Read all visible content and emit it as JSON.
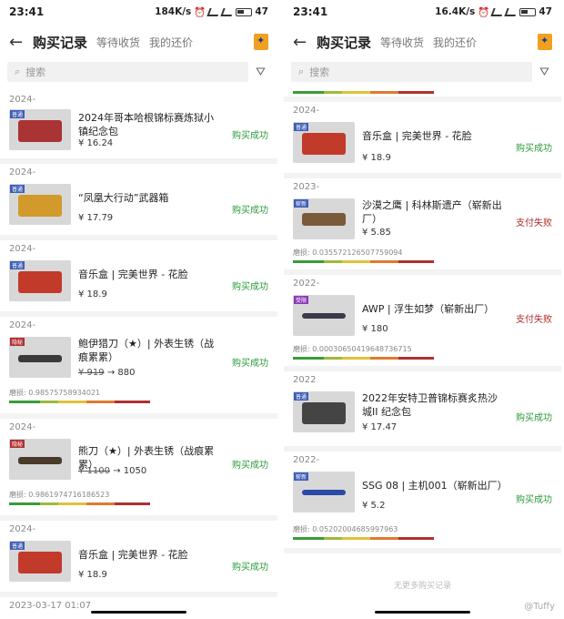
{
  "colors": {
    "success": "#2e9a3a",
    "fail": "#b02a2a"
  },
  "left": {
    "status": {
      "time": "23:41",
      "speed": "184K/s",
      "battery": "47"
    },
    "header": {
      "title": "购买记录",
      "tab1": "等待收货",
      "tab2": "我的还价"
    },
    "search": {
      "placeholder": "搜索"
    },
    "items": [
      {
        "date": "2024-",
        "name": "2024年哥本哈根锦标赛炼狱小镇纪念包",
        "price": "¥ 16.24",
        "status": "购买成功"
      },
      {
        "date": "2024-",
        "name": "“凤凰大行动”武器箱",
        "price": "¥ 17.79",
        "status": "购买成功"
      },
      {
        "date": "2024-",
        "name": "音乐盒 | 完美世界 - 花脸",
        "price": "¥ 18.9",
        "status": "购买成功"
      },
      {
        "date": "2024-",
        "name": "鲍伊猎刀（★）| 外表生锈（战痕累累）",
        "price_old": "¥ 919",
        "price_new": "880",
        "status": "购买成功",
        "wear": "磨损: 0.98575758934021"
      },
      {
        "date": "2024-",
        "name": "熊刀（★）| 外表生锈（战痕累累）",
        "price_old": "¥ 1100",
        "price_new": "1050",
        "status": "购买成功",
        "wear": "磨损: 0.9861974716186523"
      },
      {
        "date": "2024-",
        "name": "音乐盒 | 完美世界 - 花脸",
        "price": "¥ 18.9",
        "status": "购买成功"
      },
      {
        "date": "2023-03-17 01:07"
      }
    ]
  },
  "right": {
    "status": {
      "time": "23:41",
      "speed": "16.4K/s",
      "battery": "47"
    },
    "header": {
      "title": "购买记录",
      "tab1": "等待收货",
      "tab2": "我的还价"
    },
    "search": {
      "placeholder": "搜索"
    },
    "items": [
      {
        "date": "2024-",
        "name": "音乐盒 | 完美世界 - 花脸",
        "price": "¥ 18.9",
        "status": "购买成功"
      },
      {
        "date": "2023-",
        "name": "沙漠之鹰 | 科林斯遗产（崭新出厂）",
        "price": "¥ 5.85",
        "status": "支付失败",
        "wear": "磨损: 0.0355721265077590​94"
      },
      {
        "date": "2022-",
        "name": "AWP | 浮生如梦（崭新出厂）",
        "price": "¥ 180",
        "status": "支付失败",
        "wear": "磨损: 0.0003065041964873​6715"
      },
      {
        "date": "2022",
        "name": "2022年安特卫普锦标赛炙热沙城II 纪念包",
        "price": "¥ 17.47",
        "status": "购买成功"
      },
      {
        "date": "2022-",
        "name": "SSG 08 | 主机001（崭新出厂）",
        "price": "¥ 5.2",
        "status": "购买成功",
        "wear": "磨损: 0.0520200468599​7963"
      }
    ],
    "footer": "无更多购买记录"
  },
  "watermark": "@Tuffy"
}
